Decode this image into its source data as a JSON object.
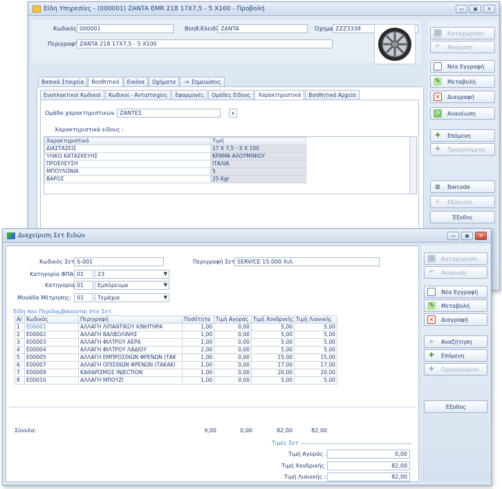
{
  "win1": {
    "title": "Είδη Υπηρεσίες - (000001) ZANTA EMR 218 17X7,5 - 5 X100 - Προβολή",
    "kodikos_label": "Κωδικός:",
    "kodikos_value": "000001",
    "voith_label": "Βοηθ.Κλειδί:",
    "voith_value": "ZANTA",
    "oxima_label": "Όχημα:",
    "oxima_value": "ZZZ3338",
    "perigrafi_label": "Περιγραφή:",
    "perigrafi_value": "ZANTA 218 17X7,5 - 5 X100",
    "main_tabs": [
      "Βασικά Στοιχεία",
      "Βοηθητικά",
      "Εικόνα",
      "Οχήματα",
      "-> Σημειώσεις"
    ],
    "sub_tabs": [
      "Εναλλακτικοί Κωδικοί",
      "Κωδικοί - Αντιστοιχίες",
      "Εφαρμογές",
      "Ομάδες Είδους",
      "Χαρακτηριστικά",
      "Βοηθητικά Αρχεία"
    ],
    "omada_label": "Ομάδα χαρακτηριστικών :",
    "omada_value": "ΖΑΝΤΕΣ",
    "clear_label": "x",
    "char_label": "Χαρακτηριστικά είδους :",
    "grid_headers": [
      "Χαρακτηριστικό",
      "Τιμή"
    ],
    "grid_rows": [
      [
        "ΔΙΑΣΤΑΣΕΙΣ",
        "17 X 7,5 - 5 X 100"
      ],
      [
        "ΥΛΙΚΟ ΚΑΤΑΣΚΕΥΗΣ",
        "ΚΡΑΜΑ ΑΛΟΥΜΙΝΙΟΥ"
      ],
      [
        "ΠΡΟΕΛΕΥΣΗ",
        "ΙΤΑΛΙΑ"
      ],
      [
        "ΜΠΟΥΛΟΝΙΑ",
        "5"
      ],
      [
        "ΒΑΡΟΣ",
        "25 Kgr"
      ]
    ],
    "buttons": [
      "Καταχώρηση",
      "Ακύρωση",
      "Νέα Εγγραφή",
      "Μεταβολή",
      "Διαγραφή",
      "Ανανέωση",
      "Επόμενη",
      "Προηγούμενη",
      "Barcode",
      "Εξαγωγή",
      "Έξοδος"
    ]
  },
  "win2": {
    "title": "Διαχείριση Σετ Ειδών",
    "kodikos_label": "Κωδικός Σετ:",
    "kodikos_value": "S-001",
    "perigrafi_label": "Περιγραφή Σετ:",
    "perigrafi_value": "SERVICE 15.000 Χιλ.",
    "fpa_label": "Κατηγορία ΦΠΑ:",
    "fpa_code": "01",
    "fpa_value": "23",
    "kat_label": "Κατηγορία:",
    "kat_code": "01",
    "kat_value": "Εμπόρευμα",
    "monada_label": "Μονάδα Μέτρησης:",
    "monada_code": "01",
    "monada_value": "Τεμάχια",
    "section_label": "Είδη που Περιλαμβάνονται στο Σετ:",
    "headers": [
      "Α/",
      "Κωδικός",
      "Περιγραφή",
      "Ποσότητα",
      "Τιμή Αγοράς",
      "Τιμή Χονδρικής",
      "Τιμή Λιανικής"
    ],
    "rows": [
      [
        "1",
        "E00001",
        "ΑΛΛΑΓΗ ΛΙΠΑΝΤΙΚΟΥ ΚΙΝΗΤΗΡΑ",
        "1,00",
        "0,00",
        "5,00",
        "5,00"
      ],
      [
        "2",
        "E00002",
        "ΑΛΛΑΓΗ ΒΑΛΒΟΛΙΝΗΣ",
        "1,00",
        "0,00",
        "5,00",
        "5,00"
      ],
      [
        "3",
        "E00003",
        "ΑΛΛΑΓΗ ΦΙΛΤΡΟΥ ΑΕΡΑ",
        "1,00",
        "0,00",
        "5,00",
        "5,00"
      ],
      [
        "4",
        "E00004",
        "ΑΛΛΑΓΗ ΦΙΛΤΡΟΥ ΛΑΔΙΟΥ",
        "2,00",
        "0,00",
        "5,00",
        "5,00"
      ],
      [
        "5",
        "E00005",
        "ΑΛΛΑΓΗ ΕΜΠΡΟΣΘΙΩΝ ΦΡΕΝΩΝ (ΤΑΚ",
        "1,00",
        "0,00",
        "15,00",
        "15,00"
      ],
      [
        "6",
        "E00007",
        "ΑΛΛΑΓΗ ΟΠΙΣΘΙΩΝ ΦΡΕΝΩΝ (ΤΑΚΑΚΙ",
        "1,00",
        "0,00",
        "17,00",
        "17,00"
      ],
      [
        "7",
        "E00009",
        "ΚΑΘΑΡΙΣΜΟΣ INJECTION",
        "1,00",
        "0,00",
        "20,00",
        "20,00"
      ],
      [
        "8",
        "E00010",
        "ΑΛΛΑΓΗ ΜΠΟΥΖΙ",
        "1,00",
        "0,00",
        "5,00",
        "5,00"
      ]
    ],
    "totals_label": "Σύνολα:",
    "totals": [
      "9,00",
      "0,00",
      "82,00",
      "82,00"
    ],
    "prices_label": "Τιμές Σετ",
    "agoras_label": "Τιμή Αγοράς :",
    "agoras_value": "0,00",
    "xondrikis_label": "Τιμή Χονδρικής :",
    "xondrikis_value": "82,00",
    "lianikis_label": "Τιμή Λιανικής :",
    "lianikis_value": "82,00",
    "buttons": [
      "Καταχώρηση",
      "Ακύρωση",
      "Νέα Εγγραφή",
      "Μεταβολή",
      "Διαγραφή",
      "Αναζήτηση",
      "Επόμενη",
      "Προηγούμενη",
      "Έξοδος"
    ]
  }
}
